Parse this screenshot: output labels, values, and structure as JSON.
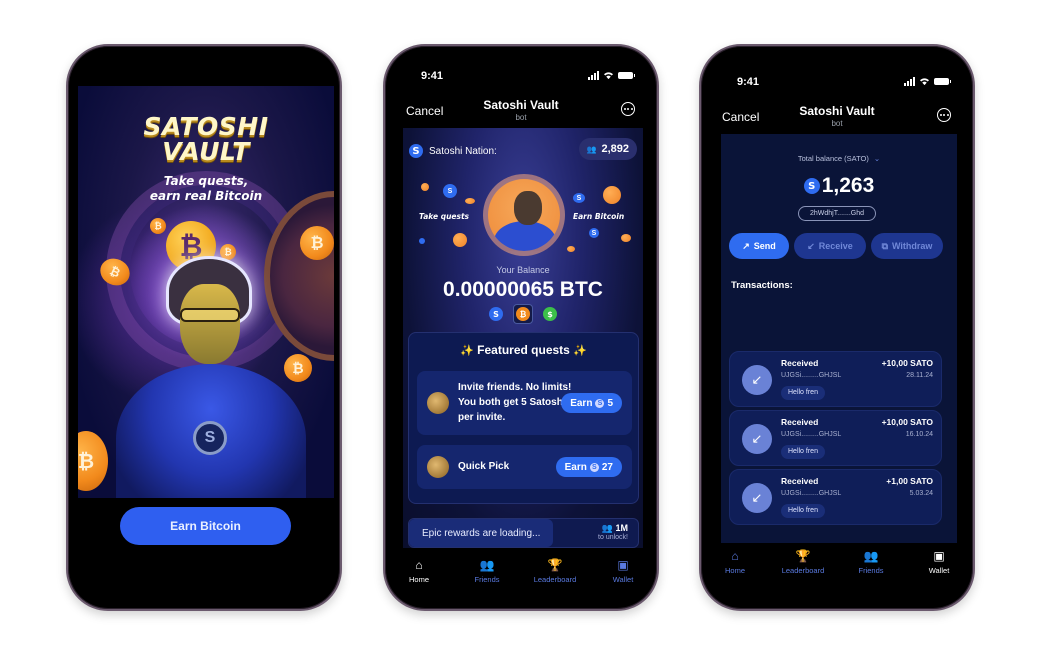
{
  "phone1": {
    "title_line1": "SATOSHI",
    "title_line2": "VAULT",
    "tagline_line1": "Take quests,",
    "tagline_line2": "earn real Bitcoin",
    "cta_label": "Earn Bitcoin",
    "colors": {
      "cta": "#2f5ff0",
      "background": "#060a38"
    }
  },
  "phone2": {
    "status": {
      "time": "9:41"
    },
    "header": {
      "cancel": "Cancel",
      "title": "Satoshi Vault",
      "subtitle": "bot"
    },
    "nation": {
      "label": "Satoshi Nation:",
      "members": "2,892"
    },
    "hero": {
      "left_text": "Take quests",
      "right_text": "Earn Bitcoin"
    },
    "balance": {
      "label": "Your Balance",
      "value": "0.00000065 BTC"
    },
    "currencies": [
      {
        "symbol": "S",
        "name": "satoshi-token",
        "color": "#2f6cf0"
      },
      {
        "symbol": "B",
        "name": "bitcoin",
        "color": "#f28a1c",
        "selected": true
      },
      {
        "symbol": "$",
        "name": "dollar",
        "color": "#3cc04a"
      }
    ],
    "featured": {
      "title": "Featured quests",
      "quests": [
        {
          "text_line1": "Invite friends. No limits!",
          "text_line2": "You both get 5 Satoshi",
          "text_line3": "per invite.",
          "button_earn": "Earn",
          "reward": "5"
        },
        {
          "text_line1": "Quick Pick",
          "button_earn": "Earn",
          "reward": "27"
        }
      ]
    },
    "progress": {
      "text": "Epic rewards are loading...",
      "goal": "1M",
      "goal_sub": "to unlock!",
      "fraction": 0.63
    },
    "tabs": [
      {
        "label": "Home",
        "icon": "home-icon",
        "active": true
      },
      {
        "label": "Friends",
        "icon": "friends-icon"
      },
      {
        "label": "Leaderboard",
        "icon": "trophy-icon"
      },
      {
        "label": "Wallet",
        "icon": "wallet-icon"
      }
    ]
  },
  "phone3": {
    "status": {
      "time": "9:41"
    },
    "header": {
      "cancel": "Cancel",
      "title": "Satoshi Vault",
      "subtitle": "bot"
    },
    "total": {
      "label": "Total balance (SATO)",
      "value": "1,263",
      "address": "2hWdhjT.......Ghd"
    },
    "actions": {
      "send": "Send",
      "receive": "Receive",
      "withdraw": "Withdraw"
    },
    "transactions_title": "Transactions:",
    "transactions": [
      {
        "type": "Received",
        "address": "UJGSi.........GHJSL",
        "note": "Hello fren",
        "amount": "+10,00 SATO",
        "date": "28.11.24"
      },
      {
        "type": "Received",
        "address": "UJGSi.........GHJSL",
        "note": "Hello fren",
        "amount": "+10,00 SATO",
        "date": "16.10.24"
      },
      {
        "type": "Received",
        "address": "UJGSi.........GHJSL",
        "note": "Hello fren",
        "amount": "+1,00 SATO",
        "date": "5.03.24"
      }
    ],
    "tabs": [
      {
        "label": "Home",
        "icon": "home-icon"
      },
      {
        "label": "Leaderboard",
        "icon": "trophy-icon"
      },
      {
        "label": "Friends",
        "icon": "friends-icon"
      },
      {
        "label": "Wallet",
        "icon": "wallet-icon",
        "active": true
      }
    ]
  }
}
